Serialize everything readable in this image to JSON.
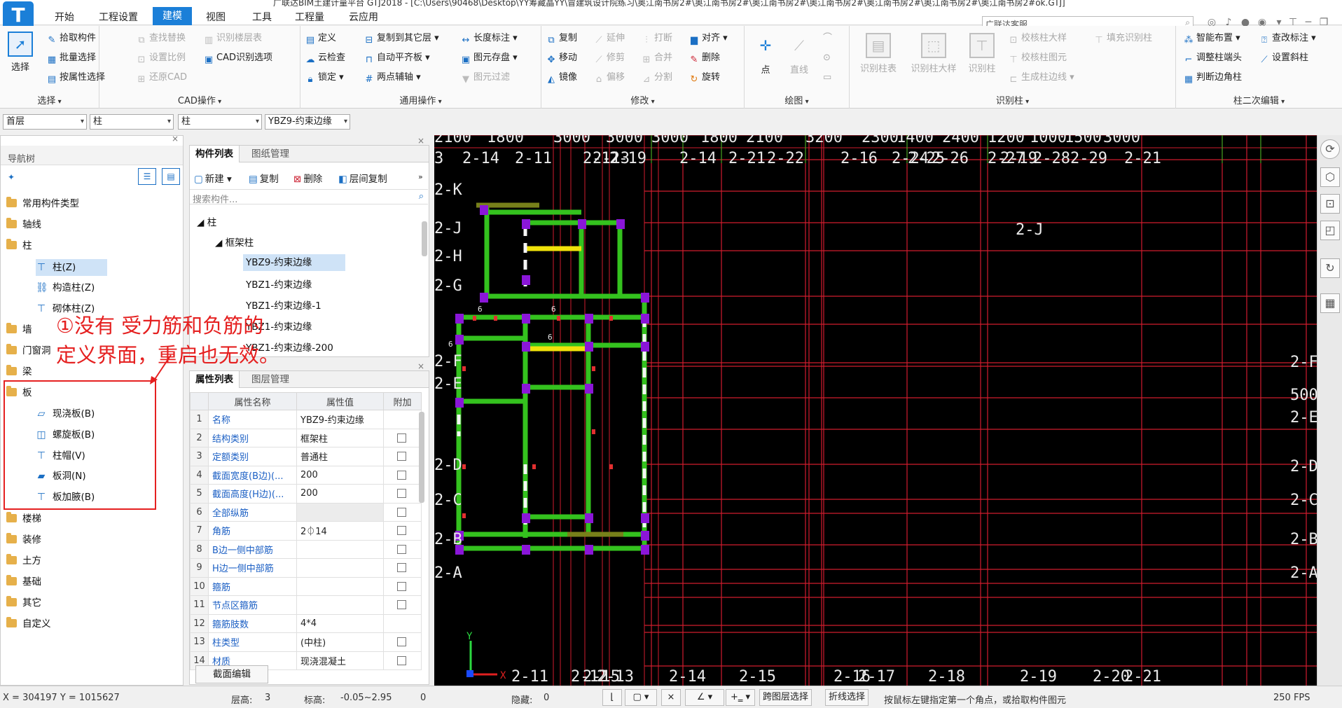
{
  "titlebar": {
    "text": "广联达BIM土建计量平台 GTJ2018 - [C:\\Users\\90468\\Desktop\\YY筹藏晶YY\\冒建筑设计院练习\\奥江南书房2#\\奥江南书房2#\\奥江南书房2#\\奥江南书房2#\\奥江南书房2#\\奥江南书房2#\\奥江南书房2#ok.GTJ]"
  },
  "menu": [
    "开始",
    "工程设置",
    "建模",
    "视图",
    "工具",
    "工程量",
    "云应用"
  ],
  "search": {
    "text": "广联达客服"
  },
  "ribbon": {
    "select": {
      "label": "选择",
      "big": "选择",
      "items": [
        "拾取构件",
        "批量选择",
        "按属性选择"
      ]
    },
    "cad": {
      "label": "CAD操作",
      "col1": [
        "查找替换",
        "设置比例",
        "还原CAD"
      ],
      "col2": [
        "识别楼层表",
        "CAD识别选项"
      ]
    },
    "general": {
      "label": "通用操作",
      "col1": [
        "定义",
        "云检查",
        "锁定"
      ],
      "col2": [
        "复制到其它层",
        "自动平齐板",
        "两点辅轴"
      ],
      "col3": [
        "长度标注",
        "图元存盘",
        "图元过滤"
      ]
    },
    "modify": {
      "label": "修改",
      "col1": [
        "复制",
        "移动",
        "镜像"
      ],
      "col2": [
        "延伸",
        "修剪",
        "偏移"
      ],
      "col3": [
        "打断",
        "合并",
        "分割"
      ],
      "col4": [
        "对齐",
        "删除",
        "旋转"
      ]
    },
    "draw": {
      "label": "绘图",
      "point": "点",
      "line": "直线"
    },
    "identify": {
      "label": "识别柱",
      "b1": "识别柱表",
      "b2": "识别柱大样",
      "b3": "识别柱",
      "col": [
        "校核柱大样",
        "校核柱图元",
        "生成柱边线"
      ],
      "fill": "填充识别柱"
    },
    "edit2": {
      "label": "柱二次编辑",
      "col1": [
        "智能布置",
        "调整柱端头",
        "判断边角柱"
      ],
      "col2": [
        "查改标注",
        "设置斜柱"
      ]
    }
  },
  "selectors": [
    "首层",
    "柱",
    "柱",
    "YBZ9-约束边缘"
  ],
  "nav": {
    "title": "导航树",
    "items": [
      "常用构件类型",
      "轴线",
      "柱",
      "柱(Z)",
      "构造柱(Z)",
      "砌体柱(Z)",
      "墙",
      "门窗洞",
      "梁",
      "板",
      "现浇板(B)",
      "螺旋板(B)",
      "柱帽(V)",
      "板洞(N)",
      "板加腋(B)",
      "楼梯",
      "装修",
      "土方",
      "基础",
      "其它",
      "自定义"
    ]
  },
  "complist": {
    "tabs": [
      "构件列表",
      "图纸管理"
    ],
    "tools": [
      "新建",
      "复制",
      "删除",
      "层间复制"
    ],
    "search": "搜索构件...",
    "root": "柱",
    "sub": "框架柱",
    "items": [
      "YBZ9-约束边缘",
      "YBZ1-约束边缘",
      "YBZ1-约束边缘-1",
      "YBZ1-约束边缘",
      "YBZ1-约束边缘-200"
    ]
  },
  "props": {
    "tabs": [
      "属性列表",
      "图层管理"
    ],
    "headers": [
      "属性名称",
      "属性值",
      "附加"
    ],
    "rows": [
      [
        "1",
        "名称",
        "YBZ9-约束边缘"
      ],
      [
        "2",
        "结构类别",
        "框架柱"
      ],
      [
        "3",
        "定额类别",
        "普通柱"
      ],
      [
        "4",
        "截面宽度(B边)(...",
        "200"
      ],
      [
        "5",
        "截面高度(H边)(...",
        "200"
      ],
      [
        "6",
        "全部纵筋",
        ""
      ],
      [
        "7",
        "角筋",
        "2⏀14"
      ],
      [
        "8",
        "B边一侧中部筋",
        ""
      ],
      [
        "9",
        "H边一侧中部筋",
        ""
      ],
      [
        "10",
        "箍筋",
        ""
      ],
      [
        "11",
        "节点区箍筋",
        ""
      ],
      [
        "12",
        "箍筋肢数",
        "4*4"
      ],
      [
        "13",
        "柱类型",
        "(中柱)"
      ],
      [
        "14",
        "材质",
        "现浇混凝土"
      ]
    ],
    "button": "截面编辑"
  },
  "annotation": {
    "line1": "①没有 受力筋和负筋的",
    "line2": "定义界面，重启也无效。"
  },
  "canvas": {
    "top_dims": [
      "2100",
      "1800",
      "3000",
      "3000",
      "3000",
      "1800",
      "2100",
      "3200",
      "2300",
      "1400",
      "2400",
      "1200",
      "1000",
      "1500",
      "3000"
    ],
    "top_axes": [
      "3",
      "2-14",
      "2-11",
      "2-12",
      "2-13",
      "2-19",
      "2-14",
      "2-21",
      "2-22",
      "2-16",
      "2-24",
      "2-25",
      "2-26",
      "2-27",
      "2-19",
      "2-28",
      "2-29",
      "2-21"
    ],
    "left_axes": [
      "2-K",
      "2-J",
      "2-H",
      "2-G",
      "2-F",
      "2-E",
      "2-D",
      "2-C",
      "2-B",
      "2-A"
    ],
    "bottom_axes": [
      "2-11",
      "2-12",
      "2-15",
      "2-13",
      "2-14",
      "2-15",
      "2-16",
      "2-17",
      "2-18",
      "2-19",
      "2-20",
      "2-21"
    ],
    "right_axes": [
      "2-F",
      "500",
      "2-E",
      "2-D",
      "2-C",
      "2-B",
      "2-A"
    ],
    "inner_axis": "2-J",
    "dim_labels": [
      "6",
      "6",
      "6",
      "6"
    ],
    "ucs": {
      "x": "X",
      "y": "Y"
    }
  },
  "status": {
    "coord": "X = 304197 Y = 1015627",
    "floor_h_label": "层高:",
    "floor_h": "3",
    "elev_label": "标高:",
    "elev": "-0.05~2.95",
    "zero": "0",
    "hidden_label": "隐藏:",
    "hidden": "0",
    "btn1": "跨图层选择",
    "btn2": "折线选择",
    "hint": "按鼠标左键指定第一个角点，或拾取构件图元",
    "fps": "250 FPS"
  },
  "colors": {
    "accent": "#1b7fd8",
    "annotation": "#e52020",
    "wall_green": "#34c21e",
    "column_purple": "#8a16d8",
    "grid_red": "#d01c2e"
  }
}
